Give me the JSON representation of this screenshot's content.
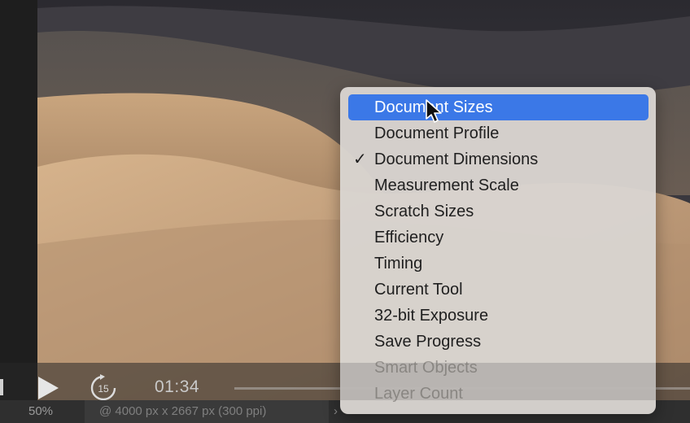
{
  "statusbar": {
    "zoom": "50%",
    "doc_info": "@ 4000 px x 2667 px (300 ppi)",
    "arrow": "›"
  },
  "video": {
    "time": "01:34",
    "skip_seconds": "15"
  },
  "menu": {
    "items": [
      {
        "label": "Document Sizes",
        "state": "highlighted"
      },
      {
        "label": "Document Profile",
        "state": "normal"
      },
      {
        "label": "Document Dimensions",
        "state": "checked"
      },
      {
        "label": "Measurement Scale",
        "state": "normal"
      },
      {
        "label": "Scratch Sizes",
        "state": "normal"
      },
      {
        "label": "Efficiency",
        "state": "normal"
      },
      {
        "label": "Timing",
        "state": "normal"
      },
      {
        "label": "Current Tool",
        "state": "normal"
      },
      {
        "label": "32-bit Exposure",
        "state": "normal"
      },
      {
        "label": "Save Progress",
        "state": "normal"
      },
      {
        "label": "Smart Objects",
        "state": "dimmed"
      },
      {
        "label": "Layer Count",
        "state": "dimmed"
      }
    ],
    "checkmark": "✓"
  },
  "colors": {
    "highlight": "#3b78e7",
    "menu_bg": "#d8d4d0",
    "status_bg": "#2f2f2f"
  },
  "icons": [
    "play-icon",
    "skip-forward-15-icon",
    "cursor-icon",
    "checkmark-icon"
  ]
}
